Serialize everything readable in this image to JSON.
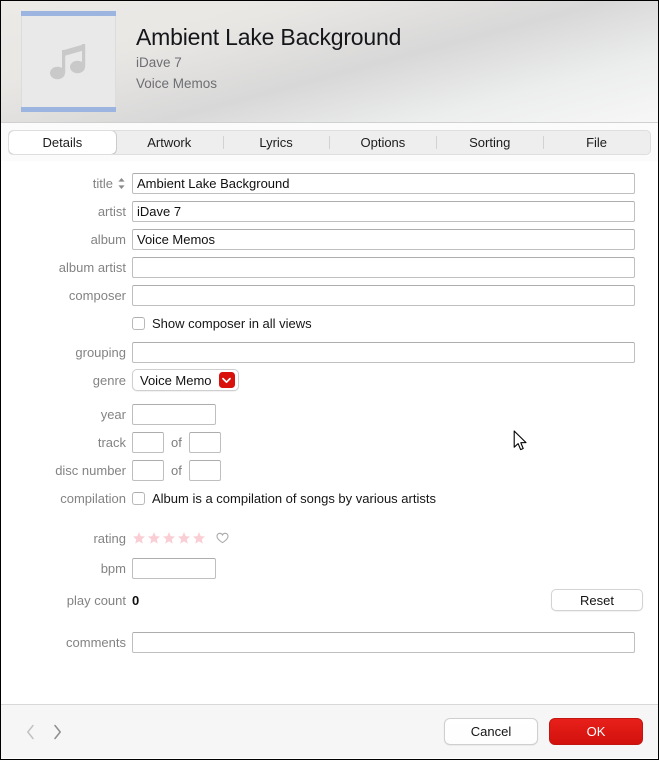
{
  "header": {
    "title": "Ambient Lake Background",
    "artist": "iDave 7",
    "album": "Voice Memos",
    "artwork_icon": "music-note-icon"
  },
  "tabs": [
    {
      "label": "Details",
      "selected": true
    },
    {
      "label": "Artwork",
      "selected": false
    },
    {
      "label": "Lyrics",
      "selected": false
    },
    {
      "label": "Options",
      "selected": false
    },
    {
      "label": "Sorting",
      "selected": false
    },
    {
      "label": "File",
      "selected": false
    }
  ],
  "form": {
    "title": {
      "label": "title",
      "value": "Ambient Lake Background",
      "placeholder": ""
    },
    "artist": {
      "label": "artist",
      "value": "iDave 7",
      "placeholder": ""
    },
    "album": {
      "label": "album",
      "value": "Voice Memos",
      "placeholder": ""
    },
    "album_artist": {
      "label": "album artist",
      "value": "",
      "placeholder": ""
    },
    "composer": {
      "label": "composer",
      "value": "",
      "placeholder": ""
    },
    "show_composer": {
      "label": "Show composer in all views",
      "checked": false
    },
    "grouping": {
      "label": "grouping",
      "value": "",
      "placeholder": ""
    },
    "genre": {
      "label": "genre",
      "value": "Voice Memo"
    },
    "year": {
      "label": "year",
      "value": "",
      "placeholder": ""
    },
    "track": {
      "label": "track",
      "value": "",
      "of_label": "of",
      "of_value": ""
    },
    "disc": {
      "label": "disc number",
      "value": "",
      "of_label": "of",
      "of_value": ""
    },
    "compilation": {
      "label": "compilation",
      "checkbox_label": "Album is a compilation of songs by various artists",
      "checked": false
    },
    "rating": {
      "label": "rating",
      "stars": 5,
      "filled": 0,
      "loved": false
    },
    "bpm": {
      "label": "bpm",
      "value": "",
      "placeholder": ""
    },
    "play_count": {
      "label": "play count",
      "value": "0",
      "reset_label": "Reset"
    },
    "comments": {
      "label": "comments",
      "value": "",
      "placeholder": ""
    }
  },
  "footer": {
    "prev_label": "previous",
    "next_label": "next",
    "cancel_label": "Cancel",
    "ok_label": "OK"
  },
  "colors": {
    "accent": "#d9110c",
    "rating_star": "#f9cfd5",
    "label_gray": "#838383",
    "artwork_bar": "#9bb4e0"
  }
}
